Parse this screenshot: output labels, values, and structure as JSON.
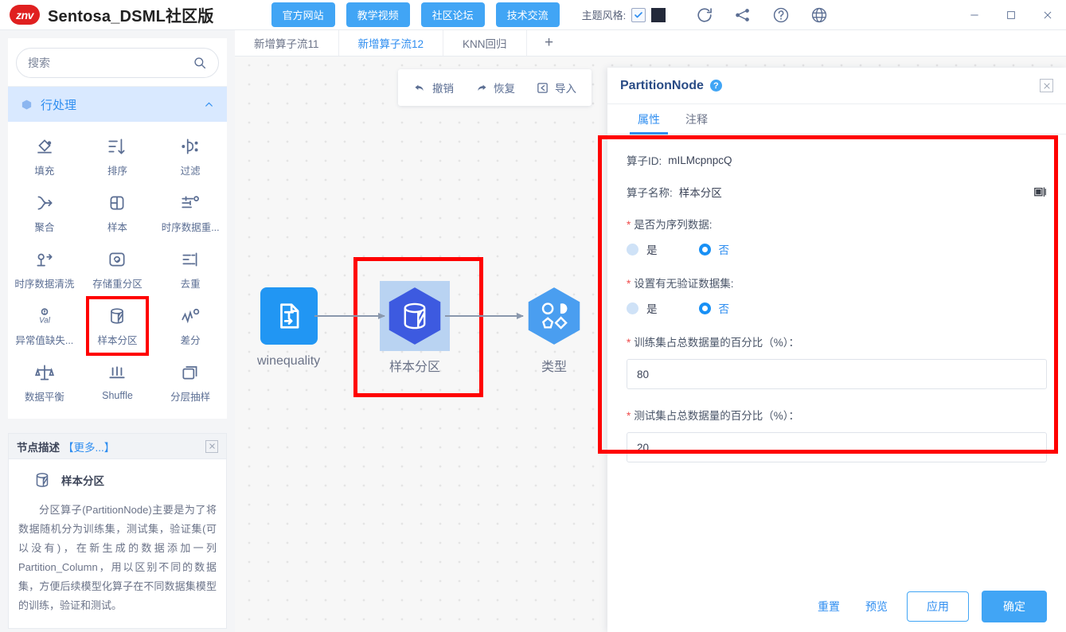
{
  "topbar": {
    "logo_text": "znv",
    "app_title": "Sentosa_DSML社区版",
    "nav_buttons": [
      {
        "label": "官方网站",
        "name": "official-website-button"
      },
      {
        "label": "教学视频",
        "name": "tutorial-video-button"
      },
      {
        "label": "社区论坛",
        "name": "community-forum-button"
      },
      {
        "label": "技术交流",
        "name": "tech-exchange-button"
      }
    ],
    "theme_label": "主题风格:",
    "theme_checked": true,
    "theme_color": "#23293a",
    "icons": [
      "refresh-icon",
      "node-graph-icon",
      "help-circle-icon",
      "globe-icon"
    ],
    "window_controls": [
      "minimize-icon",
      "maximize-icon",
      "close-icon"
    ]
  },
  "sidebar": {
    "search_placeholder": "搜索",
    "search_value": "",
    "section": {
      "title": "行处理",
      "expanded": true
    },
    "operators": [
      {
        "label": "填充",
        "icon": "fill-icon"
      },
      {
        "label": "排序",
        "icon": "sort-icon"
      },
      {
        "label": "过滤",
        "icon": "filter-icon"
      },
      {
        "label": "聚合",
        "icon": "aggregate-icon"
      },
      {
        "label": "样本",
        "icon": "sample-icon"
      },
      {
        "label": "时序数据重...",
        "icon": "timeseries-resample-icon"
      },
      {
        "label": "时序数据清洗",
        "icon": "timeseries-clean-icon"
      },
      {
        "label": "存储重分区",
        "icon": "repartition-icon"
      },
      {
        "label": "去重",
        "icon": "dedup-icon"
      },
      {
        "label": "异常值缺失...",
        "icon": "outlier-missing-icon"
      },
      {
        "label": "样本分区",
        "icon": "partition-icon",
        "highlighted": true
      },
      {
        "label": "差分",
        "icon": "difference-icon"
      },
      {
        "label": "数据平衡",
        "icon": "balance-icon"
      },
      {
        "label": "Shuffle",
        "icon": "shuffle-icon"
      },
      {
        "label": "分层抽样",
        "icon": "stratified-sampling-icon"
      }
    ],
    "description": {
      "header_title": "节点描述",
      "header_more": "【更多...】",
      "node_name": "样本分区",
      "text": "分区算子(PartitionNode)主要是为了将数据随机分为训练集，测试集，验证集(可以没有)，在新生成的数据添加一列Partition_Column，用以区别不同的数据集，方便后续模型化算子在不同数据集模型的训练，验证和测试。"
    }
  },
  "canvas": {
    "tabs": [
      {
        "label": "新增算子流11",
        "active": false
      },
      {
        "label": "新增算子流12",
        "active": true
      },
      {
        "label": "KNN回归",
        "active": false
      }
    ],
    "tab_add": "+",
    "toolbar": [
      {
        "label": "撤销",
        "icon": "undo-icon"
      },
      {
        "label": "恢复",
        "icon": "redo-icon"
      },
      {
        "label": "导入",
        "icon": "import-icon"
      }
    ],
    "nodes": [
      {
        "label": "winequality",
        "type": "source",
        "selected": false
      },
      {
        "label": "样本分区",
        "type": "partition",
        "selected": true,
        "highlighted": true
      },
      {
        "label": "类型",
        "type": "type",
        "selected": false
      }
    ]
  },
  "panel": {
    "title": "PartitionNode",
    "help": "?",
    "tabs": [
      {
        "label": "属性",
        "active": true
      },
      {
        "label": "注释",
        "active": false
      }
    ],
    "operator_id_label": "算子ID:",
    "operator_id_value": "mILMcpnpcQ",
    "operator_name_label": "算子名称:",
    "operator_name_value": "样本分区",
    "sequence_field": {
      "label": "是否为序列数据:",
      "options": [
        {
          "label": "是",
          "selected": false
        },
        {
          "label": "否",
          "selected": true
        }
      ]
    },
    "validation_field": {
      "label": "设置有无验证数据集:",
      "options": [
        {
          "label": "是",
          "selected": false
        },
        {
          "label": "否",
          "selected": true
        }
      ]
    },
    "train_field": {
      "label": "训练集占总数据量的百分比（%）：",
      "value": "80"
    },
    "test_field": {
      "label": "测试集占总数据量的百分比（%）：",
      "value": "20"
    },
    "actions": {
      "reset": "重置",
      "preview": "预览",
      "apply": "应用",
      "confirm": "确定"
    }
  }
}
